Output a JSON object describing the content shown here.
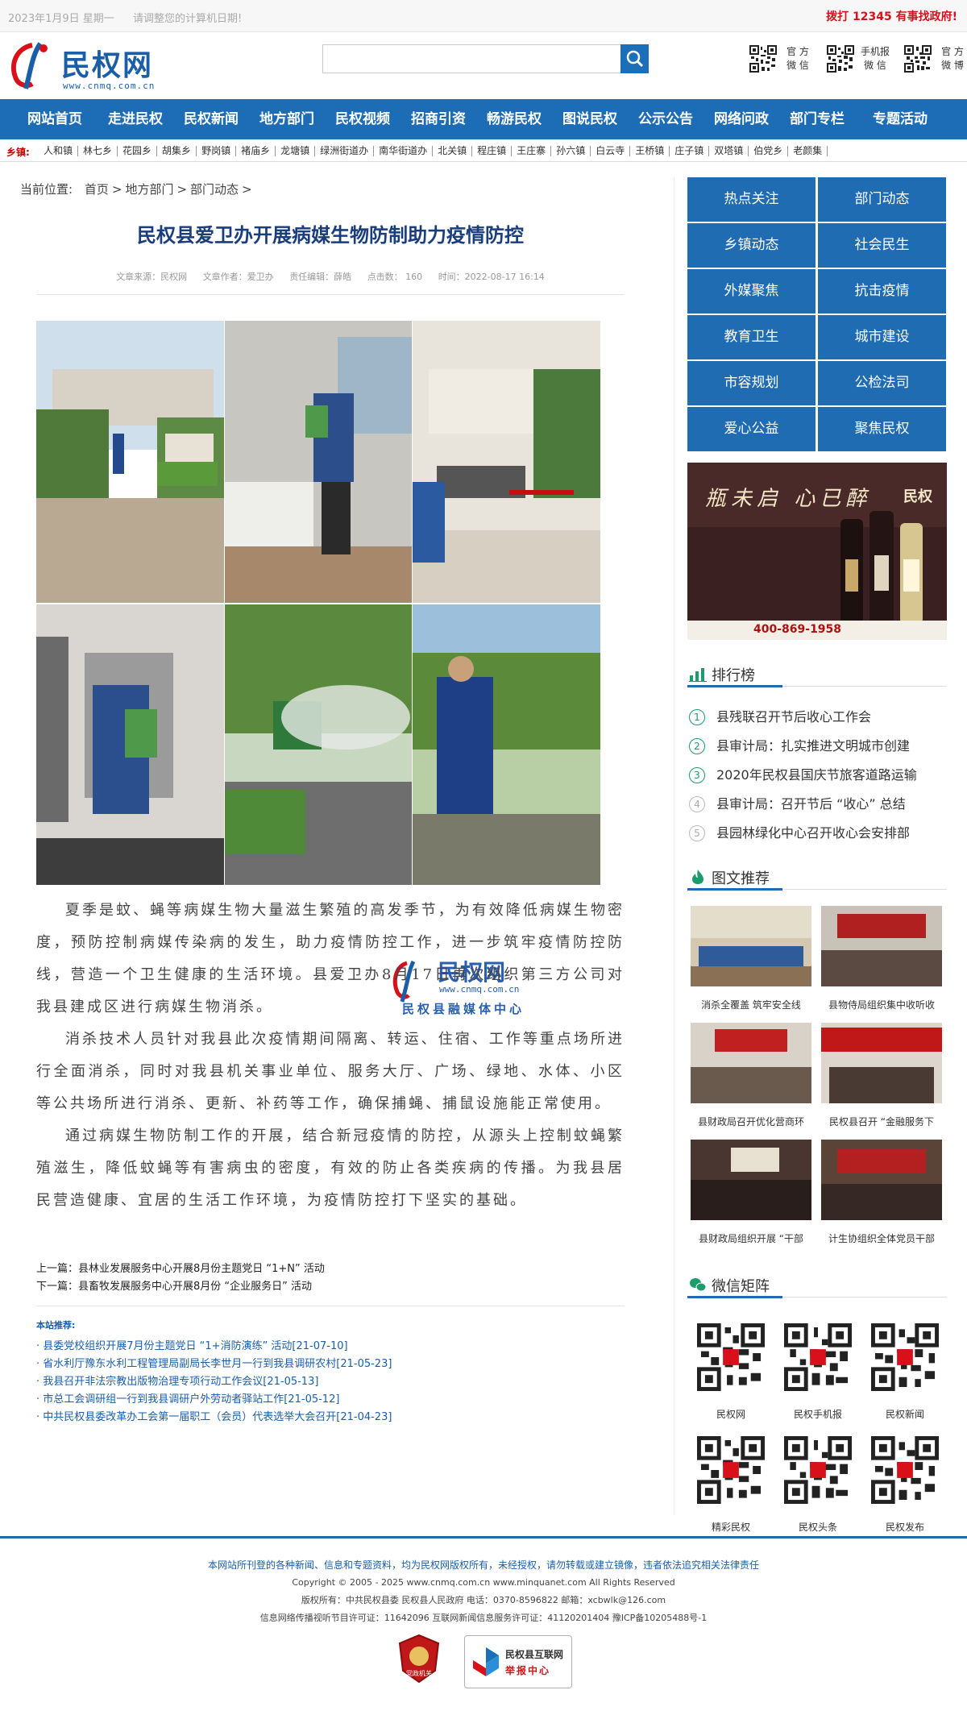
{
  "topbar": {
    "date": "2023年1月9日 星期一",
    "notice": "请调整您的计算机日期!",
    "hotline": "拨打 12345 有事找政府!"
  },
  "header": {
    "logo_text": "民权网",
    "logo_url": "www.cnmq.com.cn",
    "search_placeholder": "",
    "qr_codes": [
      {
        "label_line1": "官 方",
        "label_line2": "微 信"
      },
      {
        "label_line1": "手机报",
        "label_line2": "微 信"
      },
      {
        "label_line1": "官 方",
        "label_line2": "微 博"
      }
    ]
  },
  "nav": {
    "items": [
      "网站首页",
      "走进民权",
      "民权新闻",
      "地方部门",
      "民权视频",
      "招商引资",
      "畅游民权",
      "图说民权",
      "公示公告",
      "网络问政",
      "部门专栏",
      "专题活动"
    ]
  },
  "towns": {
    "label": "乡镇:",
    "items": [
      "人和镇",
      "林七乡",
      "花园乡",
      "胡集乡",
      "野岗镇",
      "褚庙乡",
      "龙塘镇",
      "绿洲街道办",
      "南华街道办",
      "北关镇",
      "程庄镇",
      "王庄寨",
      "孙六镇",
      "白云寺",
      "王桥镇",
      "庄子镇",
      "双塔镇",
      "伯党乡",
      "老颜集"
    ]
  },
  "breadcrumb": {
    "label": "当前位置:",
    "items": [
      "首页",
      "地方部门",
      "部门动态"
    ]
  },
  "article": {
    "title": "民权县爱卫办开展病媒生物防制助力疫情防控",
    "meta": {
      "source": "文章来源：民权网",
      "author": "文章作者：爱卫办",
      "editor": "责任编辑：薛皓",
      "clicks": "点击数： 160",
      "time": "时间：2022-08-17 16:14"
    },
    "watermark_text": "民权网",
    "watermark_url": "www.cnmq.com.cn",
    "watermark_sub": "民权县融媒体中心",
    "paragraphs": [
      "夏季是蚊、蝇等病媒生物大量滋生繁殖的高发季节，为有效降低病媒生物密度，预防控制病媒传染病的发生，助力疫情防控工作，进一步筑牢疫情防控防线，营造一个卫生健康的生活环境。县爱卫办8月17日再次组织第三方公司对我县建成区进行病媒生物消杀。",
      "消杀技术人员针对我县此次疫情期间隔离、转运、住宿、工作等重点场所进行全面消杀，同时对我县机关事业单位、服务大厅、广场、绿地、水体、小区等公共场所进行消杀、更新、补药等工作，确保捕蝇、捕鼠设施能正常使用。",
      "通过病媒生物防制工作的开展，结合新冠疫情的防控，从源头上控制蚊蝇繁殖滋生，降低蚊蝇等有害病虫的密度，有效的防止各类疾病的传播。为我县居民营造健康、宜居的生活工作环境，为疫情防控打下坚实的基础。"
    ],
    "prev": "上一篇：县林业发展服务中心开展8月份主题党日 “1+N” 活动",
    "next": "下一篇：县畜牧发展服务中心开展8月份 “企业服务日” 活动"
  },
  "recommend": {
    "title": "本站推荐:",
    "items": [
      "· 县委党校组织开展7月份主题党日 “1+消防演练” 活动[21-07-10]",
      "· 省水利厅豫东水利工程管理局副局长李世月一行到我县调研农村[21-05-23]",
      "· 我县召开非法宗教出版物治理专项行动工作会议[21-05-13]",
      "· 市总工会调研组一行到我县调研户外劳动者驿站工作[21-05-12]",
      "· 中共民权县委改革办工会第一届职工（会员）代表选举大会召开[21-04-23]"
    ]
  },
  "sidebar": {
    "categories": [
      "热点关注",
      "部门动态",
      "乡镇动态",
      "社会民生",
      "外媒聚焦",
      "抗击疫情",
      "教育卫生",
      "城市建设",
      "市容规划",
      "公检法司",
      "爱心公益",
      "聚焦民权"
    ],
    "ad": {
      "slogan": "瓶未启 心已醉",
      "brand": "民权",
      "phone": "400-869-1958"
    },
    "rank_title": "排行榜",
    "rank": [
      "县残联召开节后收心工作会",
      "县审计局：扎实推进文明城市创建",
      "2020年民权县国庆节旅客道路运输",
      "县审计局：召开节后 “收心” 总结",
      "县园林绿化中心召开收心会安排部"
    ],
    "photo_title": "图文推荐",
    "photos": [
      "消杀全覆盖 筑牢安全线",
      "县物侍局组织集中收听收",
      "县财政局召开优化营商环",
      "民权县召开 “金融服务下",
      "县财政局组织开展 “干部",
      "计生协组织全体党员干部"
    ],
    "wechat_title": "微信矩阵",
    "wechat": [
      "民权网",
      "民权手机报",
      "民权新闻",
      "精彩民权",
      "民权头条",
      "民权发布"
    ]
  },
  "footer": {
    "line1": "本网站所刊登的各种新闻、信息和专题资料，均为民权网版权所有，未经授权，请勿转载或建立镜像，违者依法追究相关法律责任",
    "line2": "Copyright © 2005 - 2025 www.cnmq.com.cn www.minquanet.com All Rights Reserved",
    "line3": "版权所有：中共民权县委 民权县人民政府 电话：0370-8596822 邮箱：xcbwlk@126.com",
    "line4": "信息网络传播视听节目许可证：11642096 互联网新闻信息服务许可证：41120201404 豫ICP备10205488号-1",
    "badge1_text": "党政机关",
    "badge2_line1": "民权县互联网",
    "badge2_line2": "举报中心"
  }
}
